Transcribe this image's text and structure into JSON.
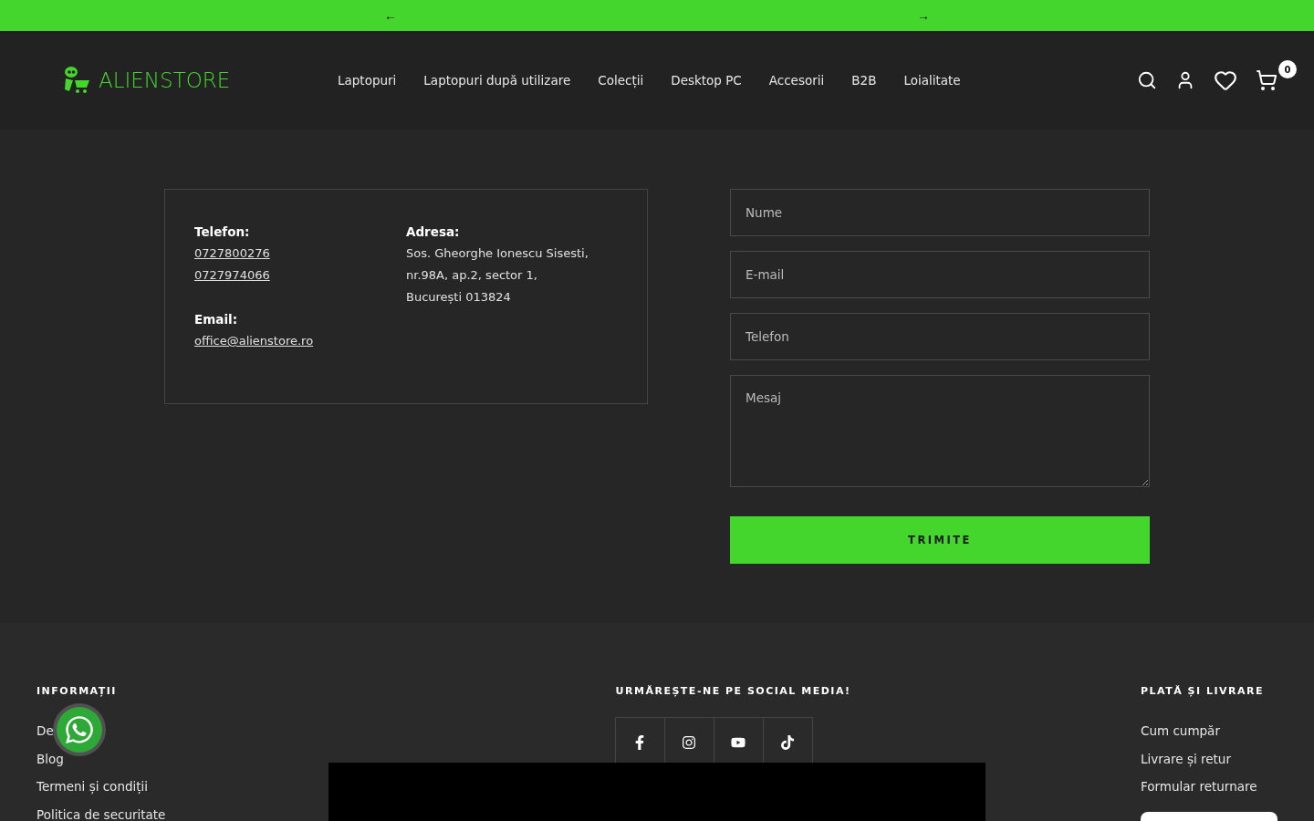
{
  "announcement_bar": {
    "prev": "←",
    "next": "→"
  },
  "header": {
    "logo": "ALIENSTORE",
    "nav": [
      {
        "label": "Laptopuri"
      },
      {
        "label": "Laptopuri după utilizare"
      },
      {
        "label": "Colecții"
      },
      {
        "label": "Desktop PC"
      },
      {
        "label": "Accesorii"
      },
      {
        "label": "B2B"
      },
      {
        "label": "Loialitate"
      }
    ],
    "cart_count": "0"
  },
  "contact": {
    "phone_label": "Telefon:",
    "phones": [
      "0727800276",
      "0727974066"
    ],
    "email_label": "Email:",
    "email": "office@alienstore.ro",
    "address_label": "Adresa:",
    "address_lines": [
      "Sos. Gheorghe Ionescu Sisesti,",
      "nr.98A, ap.2, sector 1,",
      "București 013824"
    ]
  },
  "form": {
    "fields": [
      {
        "kind": "input",
        "placeholder": "Nume"
      },
      {
        "kind": "input",
        "placeholder": "E-mail"
      },
      {
        "kind": "input",
        "placeholder": "Telefon"
      },
      {
        "kind": "textarea",
        "placeholder": "Mesaj"
      }
    ],
    "submit": "TRIMITE"
  },
  "footer": {
    "columns": [
      {
        "kind": "links",
        "title": "INFORMAȚII",
        "links": [
          "De",
          "Blog",
          "Termeni și condiții",
          "Politica de securitate"
        ]
      },
      {
        "kind": "social",
        "title": "URMĂREȘTE-NE PE SOCIAL MEDIA!"
      },
      {
        "kind": "links",
        "title": "PLATĂ ȘI LIVRARE",
        "links": [
          "Cum cumpăr",
          "Livrare și retur",
          "Formular returnare"
        ]
      }
    ]
  }
}
